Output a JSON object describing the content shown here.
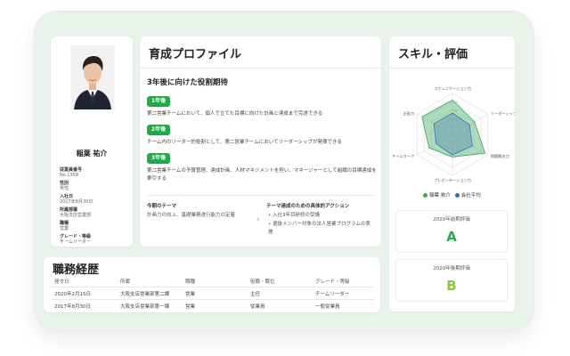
{
  "profile": {
    "name": "稲葉 祐介",
    "fields": [
      {
        "label": "従業員番号",
        "value": "No.1358"
      },
      {
        "label": "性別",
        "value": "男性"
      },
      {
        "label": "入社日",
        "value": "2017年8月30日"
      },
      {
        "label": "所属部署",
        "value": "大阪支店営業部"
      },
      {
        "label": "職種",
        "value": "営業"
      },
      {
        "label": "グレード・等級",
        "value": "チームリーダー"
      }
    ]
  },
  "development": {
    "title": "育成プロファイル",
    "subtitle": "3年後に向けた役割期待",
    "goals": [
      {
        "badge": "1年後",
        "text": "第二営業チームにおいて、個人で立てた目標に向けた計画と達成まで完遂できる"
      },
      {
        "badge": "2年後",
        "text": "チーム内のリーダー的役割として、第二営業チームにおいてリーダーシップが発揮できる"
      },
      {
        "badge": "3年後",
        "text": "第二営業チームの予算管理、達成計画、人材マネジメントを担い、マネージャーとして組織の目標達成を牽引する"
      }
    ],
    "theme_label": "今期のテーマ",
    "theme_text": "計画力の向上、基礎業務遂行能力の定着",
    "actions_label": "テーマ達成のための具体的アクション",
    "actions": [
      "入社3年目研修の受講",
      "選抜メンバー対象の法人営業プログラムの実施"
    ]
  },
  "skills": {
    "title": "スキル・評価",
    "axes": [
      "コミュニケーション力",
      "リーダーシップ",
      "問題解決力",
      "プレゼンテーション力",
      "チームワーク",
      "企画力"
    ],
    "ticks": [
      "20",
      "40",
      "60",
      "80"
    ],
    "legend": [
      "稲葉 祐介",
      "会社平均"
    ],
    "evaluations": [
      {
        "label": "2020年前期評価",
        "grade": "A"
      },
      {
        "label": "2020年後期評価",
        "grade": "B"
      }
    ]
  },
  "colors": {
    "accent": "#22a84a",
    "person": "#4caf6a",
    "average": "#2f6fb3",
    "grade_a": "#2eaa4e",
    "grade_b": "#8cc63f"
  },
  "career": {
    "title": "職務経歴",
    "headers": [
      "発令日",
      "所属",
      "職種",
      "役職・職位",
      "グレード・等級"
    ],
    "rows": [
      [
        "2020年2月15日",
        "大阪支店営業部第二課",
        "営業",
        "主任",
        "チームリーダー"
      ],
      [
        "2017年8月30日",
        "大阪支店営業部第一課",
        "営業",
        "従業員",
        "一般従業員"
      ]
    ]
  }
}
